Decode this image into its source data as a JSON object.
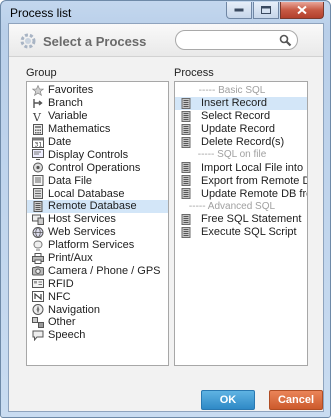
{
  "window": {
    "title": "Process list"
  },
  "header": {
    "title": "Select a Process",
    "search_placeholder": ""
  },
  "group": {
    "label": "Group",
    "items": [
      {
        "label": "Favorites",
        "icon": "star-icon"
      },
      {
        "label": "Branch",
        "icon": "branch-icon"
      },
      {
        "label": "Variable",
        "icon": "variable-icon"
      },
      {
        "label": "Mathematics",
        "icon": "calculator-icon"
      },
      {
        "label": "Date",
        "icon": "calendar-icon"
      },
      {
        "label": "Display Controls",
        "icon": "display-controls-icon"
      },
      {
        "label": "Control Operations",
        "icon": "control-operations-icon"
      },
      {
        "label": "Data File",
        "icon": "data-file-icon"
      },
      {
        "label": "Local Database",
        "icon": "local-database-icon"
      },
      {
        "label": "Remote Database",
        "icon": "remote-database-icon",
        "selected": true
      },
      {
        "label": "Host Services",
        "icon": "host-services-icon"
      },
      {
        "label": "Web Services",
        "icon": "web-services-icon"
      },
      {
        "label": "Platform Services",
        "icon": "platform-services-icon"
      },
      {
        "label": "Print/Aux",
        "icon": "printer-icon"
      },
      {
        "label": "Camera / Phone / GPS",
        "icon": "camera-icon"
      },
      {
        "label": "RFID",
        "icon": "rfid-icon"
      },
      {
        "label": "NFC",
        "icon": "nfc-icon"
      },
      {
        "label": "Navigation",
        "icon": "navigation-icon"
      },
      {
        "label": "Other",
        "icon": "other-icon"
      },
      {
        "label": "Speech",
        "icon": "speech-icon"
      }
    ]
  },
  "process": {
    "label": "Process",
    "items": [
      {
        "label": "----- Basic SQL",
        "separator": true
      },
      {
        "label": "Insert Record",
        "selected": true
      },
      {
        "label": "Select Record"
      },
      {
        "label": "Update Record"
      },
      {
        "label": "Delete Record(s)"
      },
      {
        "label": "----- SQL on file",
        "separator": true
      },
      {
        "label": "Import Local File into R"
      },
      {
        "label": "Export from Remote DB"
      },
      {
        "label": "Update Remote DB fron"
      },
      {
        "label": "----- Advanced SQL",
        "separator": true
      },
      {
        "label": "Free SQL Statement"
      },
      {
        "label": "Execute SQL Script"
      }
    ]
  },
  "buttons": {
    "ok": "OK",
    "cancel": "Cancel"
  }
}
